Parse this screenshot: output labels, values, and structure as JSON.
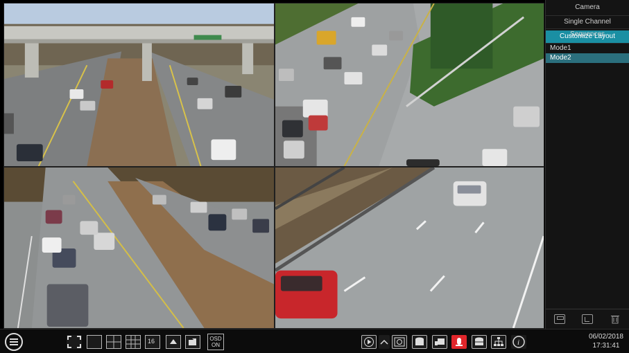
{
  "panel": {
    "title": "Camera",
    "sequence_label": "Single Channel Sequences",
    "customize_label": "Customize Layout",
    "modes": [
      "Mode1",
      "Mode2"
    ],
    "active_mode": "Mode2"
  },
  "toolbar": {
    "osd_line1": "OSD",
    "osd_line2": "ON",
    "sixteen_label": "16",
    "date": "06/02/2018",
    "time": "17:31:41"
  },
  "colors": {
    "accent": "#1a8fa3",
    "active_row": "#2b6f7d",
    "alarm": "#e0262b"
  }
}
